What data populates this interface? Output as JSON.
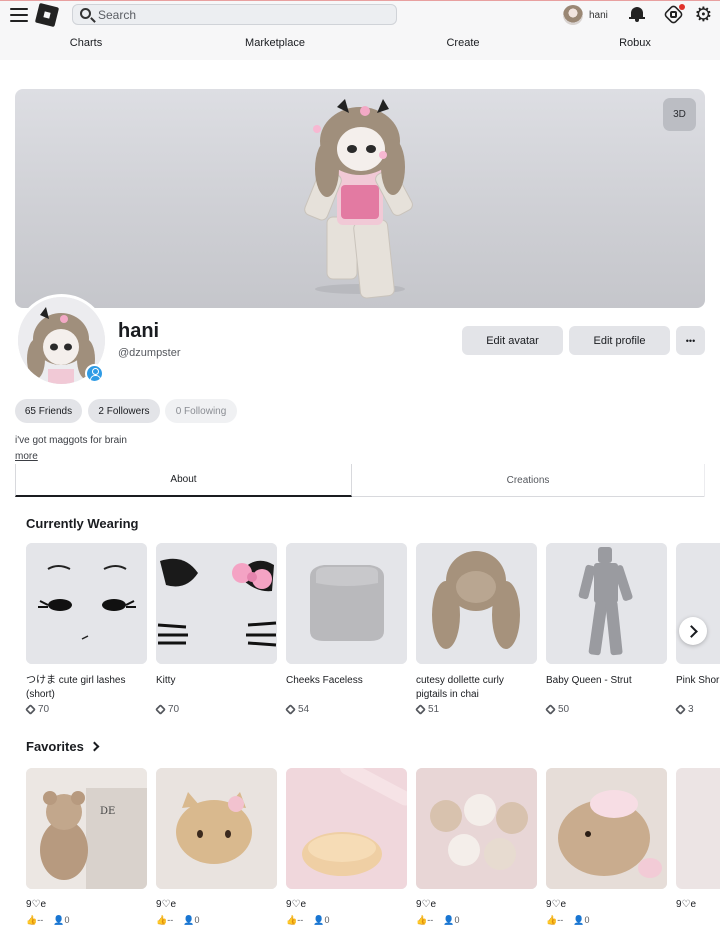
{
  "header": {
    "search_placeholder": "Search",
    "user_name": "hani",
    "nav": [
      "Charts",
      "Marketplace",
      "Create",
      "Robux"
    ]
  },
  "banner": {
    "btn_3d": "3D"
  },
  "profile": {
    "display_name": "hani",
    "username": "@dzumpster",
    "edit_avatar": "Edit avatar",
    "edit_profile": "Edit profile",
    "more_menu": "•••",
    "friends": "65 Friends",
    "followers": "2 Followers",
    "following": "0 Following",
    "bio": "i've got maggots for brain",
    "more": "more"
  },
  "tabs": {
    "about": "About",
    "creations": "Creations"
  },
  "currently_wearing": {
    "title": "Currently Wearing",
    "items": [
      {
        "name": "つけま cute girl lashes (short)",
        "price": "70"
      },
      {
        "name": "Kitty",
        "price": "70"
      },
      {
        "name": "Cheeks Faceless",
        "price": "54"
      },
      {
        "name": "cutesy dollette curly pigtails in chai",
        "price": "51"
      },
      {
        "name": "Baby Queen - Strut",
        "price": "50"
      },
      {
        "name": "Pink Shor",
        "price": "3"
      }
    ]
  },
  "favorites": {
    "title": "Favorites",
    "items": [
      {
        "title": "9♡e",
        "likes": "--",
        "players": "0"
      },
      {
        "title": "9♡e",
        "likes": "--",
        "players": "0"
      },
      {
        "title": "9♡e",
        "likes": "--",
        "players": "0"
      },
      {
        "title": "9♡e",
        "likes": "--",
        "players": "0"
      },
      {
        "title": "9♡e",
        "likes": "--",
        "players": "0"
      },
      {
        "title": "9♡e",
        "likes": "",
        "players": ""
      }
    ]
  },
  "colors": {
    "accent_blue": "#2f9be5",
    "notification_red": "#e0322b"
  }
}
